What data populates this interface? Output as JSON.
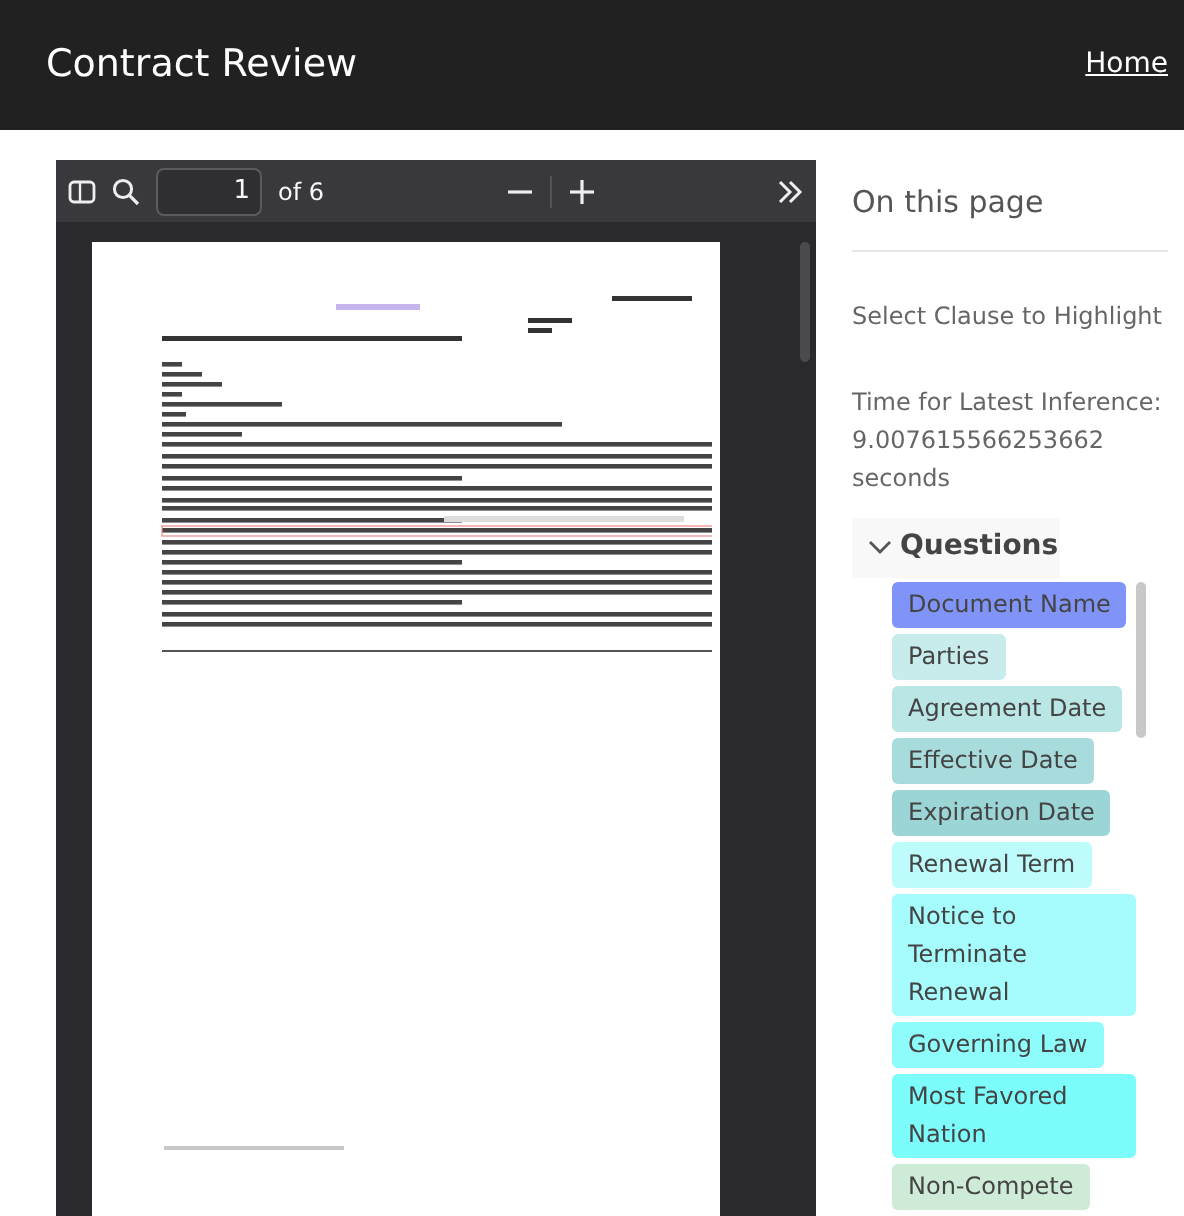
{
  "header": {
    "title": "Contract Review",
    "nav_link": "Home"
  },
  "viewer": {
    "page_number": "1",
    "page_count": "of 6"
  },
  "sidebar": {
    "heading": "On this page",
    "instruction": "Select Clause to Highlight",
    "inference_label": "Time for Latest Inference:",
    "inference_value": "9.007615566253662",
    "inference_unit": "seconds",
    "questions": {
      "title": "Questions",
      "expanded": true,
      "items": [
        {
          "label": "Document Name",
          "color": "#8094f8"
        },
        {
          "label": "Parties",
          "color": "#c8eceb"
        },
        {
          "label": "Agreement Date",
          "color": "#bae6e6"
        },
        {
          "label": "Effective Date",
          "color": "#a8dcdc"
        },
        {
          "label": "Expiration Date",
          "color": "#9cd5d6"
        },
        {
          "label": "Renewal Term",
          "color": "#befcfc"
        },
        {
          "label": "Notice to Terminate Renewal",
          "color": "#a6fcfc"
        },
        {
          "label": "Governing Law",
          "color": "#8ffcfc"
        },
        {
          "label": "Most Favored Nation",
          "color": "#7dfcfc"
        },
        {
          "label": "Non-Compete",
          "color": "#cdebd6"
        }
      ]
    }
  }
}
